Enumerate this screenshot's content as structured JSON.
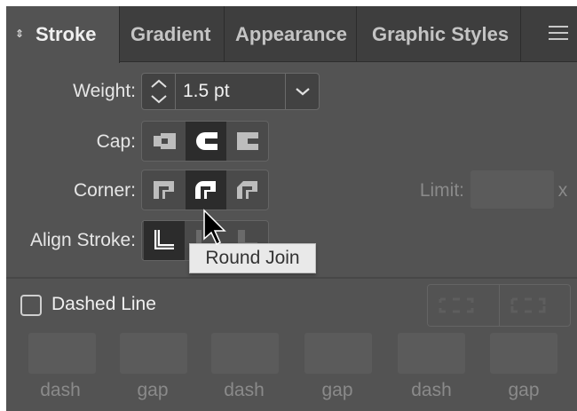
{
  "tabs": [
    {
      "label": "Stroke",
      "active": true
    },
    {
      "label": "Gradient",
      "active": false
    },
    {
      "label": "Appearance",
      "active": false
    },
    {
      "label": "Graphic Styles",
      "active": false
    }
  ],
  "weight": {
    "label": "Weight:",
    "value": "1.5 pt"
  },
  "cap": {
    "label": "Cap:",
    "buttons": [
      "butt-cap",
      "round-cap",
      "projecting-cap"
    ],
    "selected": "round-cap"
  },
  "corner": {
    "label": "Corner:",
    "buttons": [
      "miter-join",
      "round-join",
      "bevel-join"
    ],
    "selected": "round-join"
  },
  "limit": {
    "label": "Limit:",
    "value": "",
    "suffix": "x"
  },
  "align_stroke": {
    "label": "Align Stroke:",
    "buttons": [
      "align-center",
      "align-inside",
      "align-outside"
    ],
    "selected": "align-center"
  },
  "tooltip": "Round Join",
  "dashed": {
    "label": "Dashed Line",
    "checked": false
  },
  "dash_fields": [
    "dash",
    "gap",
    "dash",
    "gap",
    "dash",
    "gap"
  ],
  "colors": {
    "panel": "#535353",
    "tabbar": "#3e3e3e",
    "selected_button": "#2c2c2c",
    "tooltip": "#e9e9e9"
  }
}
